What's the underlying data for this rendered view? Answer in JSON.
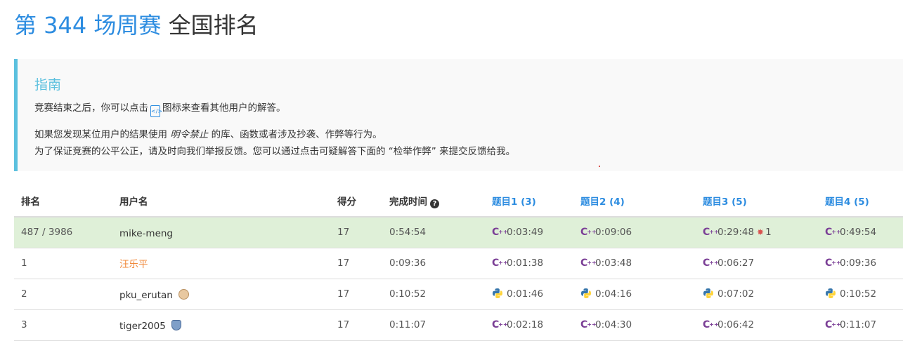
{
  "header": {
    "title_accent": "第 344 场周赛",
    "title_rest": "全国排名"
  },
  "guide": {
    "title": "指南",
    "line1_a": "竞赛结束之后，你可以点击",
    "line1_b": "图标来查看其他用户的解答。",
    "line2_a": "如果您发现某位用户的结果使用",
    "line2_em": "明令禁止",
    "line2_b": "的库、函数或者涉及抄袭、作弊等行为。",
    "line3": "为了保证竞赛的公平公正，请及时向我们举报反馈。您可以通过点击可疑解答下面的 “检举作弊” 来提交反馈给我。",
    "code_icon": "code-file-icon"
  },
  "table": {
    "headers": {
      "rank": "排名",
      "username": "用户名",
      "score": "得分",
      "finish_time": "完成时间",
      "q1": "题目1 (3)",
      "q2": "题目2 (4)",
      "q3": "题目3 (5)",
      "q4": "题目4 (5)"
    },
    "rows": [
      {
        "rank": "487 / 3986",
        "username": "mike-meng",
        "score": "17",
        "finish_time": "0:54:54",
        "lang": "cpp",
        "q1": "0:03:49",
        "q2": "0:09:06",
        "q3": "0:29:48",
        "q3_penalty": "1",
        "q4": "0:49:54",
        "highlight": true
      },
      {
        "rank": "1",
        "username": "汪乐平",
        "score": "17",
        "finish_time": "0:09:36",
        "lang": "cpp",
        "q1": "0:01:38",
        "q2": "0:03:48",
        "q3": "0:06:27",
        "q4": "0:09:36",
        "username_color": "#f0883a"
      },
      {
        "rank": "2",
        "username": "pku_erutan",
        "score": "17",
        "finish_time": "0:10:52",
        "lang": "python",
        "q1": "0:01:46",
        "q2": "0:04:16",
        "q3": "0:07:02",
        "q4": "0:10:52",
        "badge": "guardian-badge-icon"
      },
      {
        "rank": "3",
        "username": "tiger2005",
        "score": "17",
        "finish_time": "0:11:07",
        "lang": "cpp",
        "q1": "0:02:18",
        "q2": "0:04:30",
        "q3": "0:06:42",
        "q4": "0:11:07",
        "badge": "knight-badge-icon"
      }
    ]
  },
  "colors": {
    "accent": "#2c8ce0",
    "guide_border": "#5bc0de",
    "self_row": "#dff0d8",
    "cpp": "#7b3f96",
    "bug": "#d9534f"
  }
}
